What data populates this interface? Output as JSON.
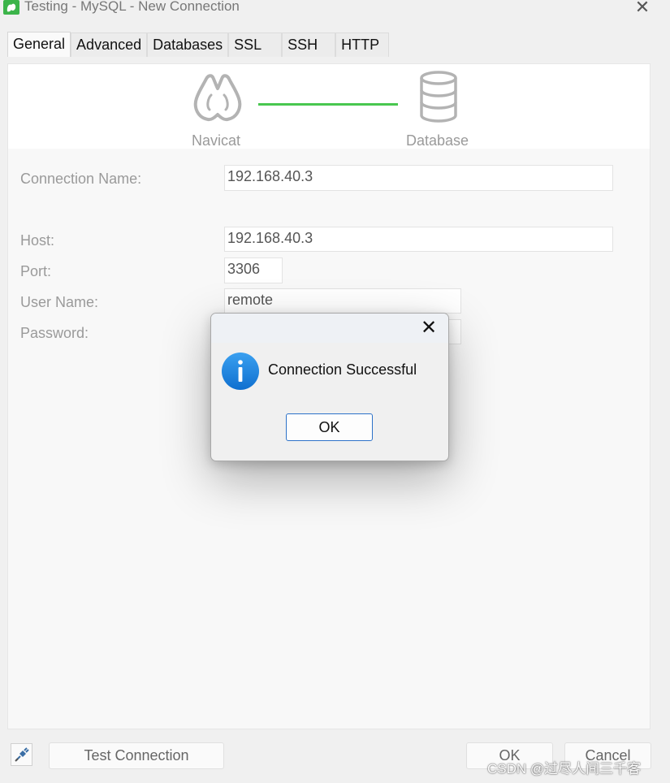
{
  "window": {
    "title": "Testing - MySQL - New Connection",
    "close_symbol": "✕"
  },
  "tabs": [
    {
      "label": "General",
      "active": true
    },
    {
      "label": "Advanced",
      "active": false
    },
    {
      "label": "Databases",
      "active": false
    },
    {
      "label": "SSL",
      "active": false
    },
    {
      "label": "SSH",
      "active": false
    },
    {
      "label": "HTTP",
      "active": false
    }
  ],
  "graphic": {
    "left_label": "Navicat",
    "right_label": "Database",
    "link_color": "#49c74f"
  },
  "form": {
    "connection_name_label": "Connection Name:",
    "connection_name_value": "192.168.40.3",
    "host_label": "Host:",
    "host_value": "192.168.40.3",
    "port_label": "Port:",
    "port_value": "3306",
    "user_name_label": "User Name:",
    "user_name_value": "remote",
    "password_label": "Password:",
    "password_value": ""
  },
  "footer": {
    "test_connection_label": "Test Connection",
    "ok_label": "OK",
    "cancel_label": "Cancel"
  },
  "dialog": {
    "message": "Connection Successful",
    "ok_label": "OK",
    "close_symbol": "✕",
    "icon": "info-icon",
    "accent": "#1a7fd8"
  },
  "watermark": "CSDN @过尽人间三千客"
}
